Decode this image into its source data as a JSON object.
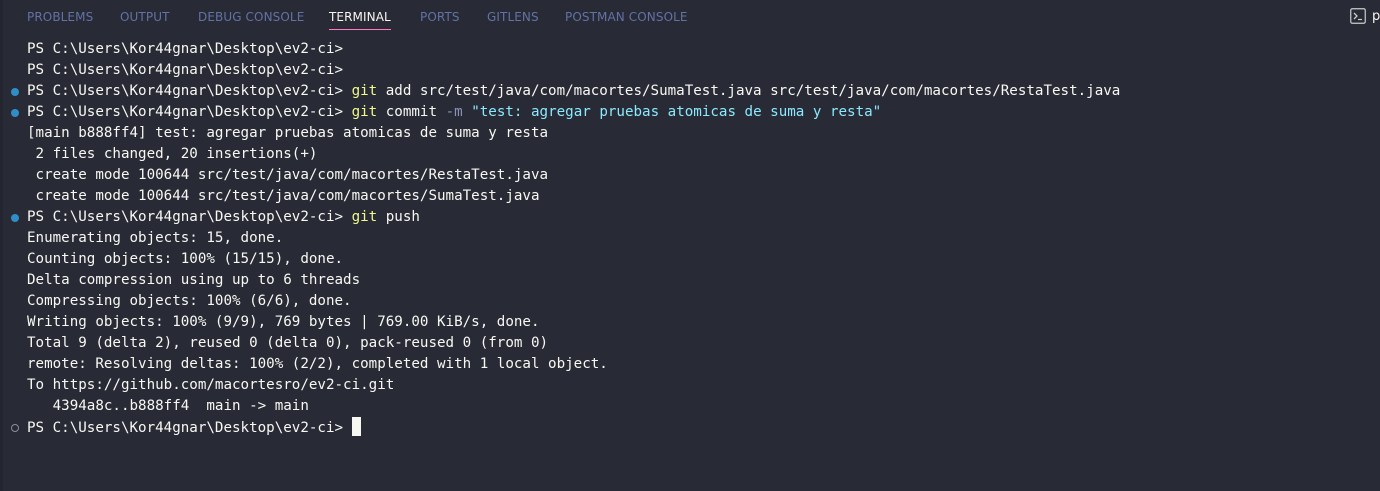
{
  "tabs": [
    {
      "label": "PROBLEMS",
      "active": false
    },
    {
      "label": "OUTPUT",
      "active": false
    },
    {
      "label": "DEBUG CONSOLE",
      "active": false
    },
    {
      "label": "TERMINAL",
      "active": true
    },
    {
      "label": "PORTS",
      "active": false
    },
    {
      "label": "GITLENS",
      "active": false
    },
    {
      "label": "POSTMAN CONSOLE",
      "active": false
    }
  ],
  "toolbar": {
    "terminal_icon": "terminal-icon",
    "overflow_text": "p"
  },
  "colors": {
    "background": "#282a36",
    "foreground": "#f8f8f2",
    "inactive_tab": "#6272a4",
    "active_tab_underline": "#ff79c6",
    "command": "#f1fa8c",
    "string": "#8be9fd",
    "success_decoration": "#2e8fc7"
  },
  "terminal": {
    "prompt": "PS C:\\Users\\Kor44gnar\\Desktop\\ev2-ci> ",
    "lines": [
      {
        "kind": "prompt",
        "decoration": "none",
        "segments": []
      },
      {
        "kind": "prompt",
        "decoration": "none",
        "segments": []
      },
      {
        "kind": "prompt",
        "decoration": "success",
        "segments": [
          {
            "text": "git",
            "type": "cmd"
          },
          {
            "text": " add src/test/java/com/macortes/SumaTest.java src/test/java/com/macortes/RestaTest.java",
            "type": "plain"
          }
        ]
      },
      {
        "kind": "prompt",
        "decoration": "success",
        "segments": [
          {
            "text": "git",
            "type": "cmd"
          },
          {
            "text": " commit ",
            "type": "plain"
          },
          {
            "text": "-m",
            "type": "flag"
          },
          {
            "text": " ",
            "type": "plain"
          },
          {
            "text": "\"test: agregar pruebas atomicas de suma y resta\"",
            "type": "str"
          }
        ]
      },
      {
        "kind": "output",
        "text": "[main b888ff4] test: agregar pruebas atomicas de suma y resta"
      },
      {
        "kind": "output",
        "text": " 2 files changed, 20 insertions(+)"
      },
      {
        "kind": "output",
        "text": " create mode 100644 src/test/java/com/macortes/RestaTest.java"
      },
      {
        "kind": "output",
        "text": " create mode 100644 src/test/java/com/macortes/SumaTest.java"
      },
      {
        "kind": "prompt",
        "decoration": "success",
        "segments": [
          {
            "text": "git",
            "type": "cmd"
          },
          {
            "text": " push",
            "type": "plain"
          }
        ]
      },
      {
        "kind": "output",
        "text": "Enumerating objects: 15, done."
      },
      {
        "kind": "output",
        "text": "Counting objects: 100% (15/15), done."
      },
      {
        "kind": "output",
        "text": "Delta compression using up to 6 threads"
      },
      {
        "kind": "output",
        "text": "Compressing objects: 100% (6/6), done."
      },
      {
        "kind": "output",
        "text": "Writing objects: 100% (9/9), 769 bytes | 769.00 KiB/s, done."
      },
      {
        "kind": "output",
        "text": "Total 9 (delta 2), reused 0 (delta 0), pack-reused 0 (from 0)"
      },
      {
        "kind": "output",
        "text": "remote: Resolving deltas: 100% (2/2), completed with 1 local object."
      },
      {
        "kind": "output",
        "text": "To https://github.com/macortesro/ev2-ci.git"
      },
      {
        "kind": "output",
        "text": "   4394a8c..b888ff4  main -> main"
      },
      {
        "kind": "prompt",
        "decoration": "pending",
        "cursor": true,
        "segments": []
      }
    ]
  }
}
